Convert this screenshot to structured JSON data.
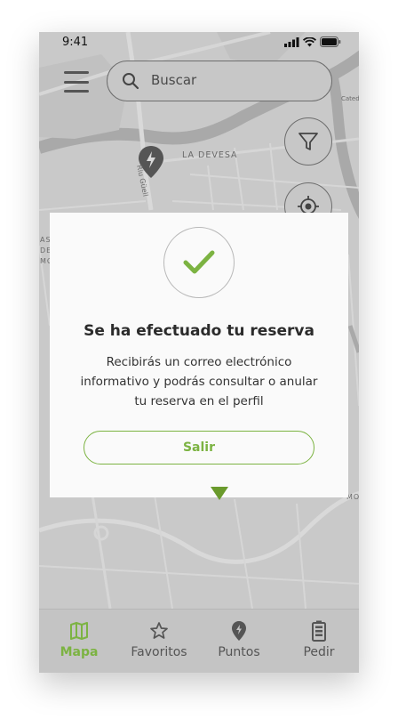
{
  "status_bar": {
    "time": "9:41"
  },
  "search": {
    "placeholder": "Buscar"
  },
  "map": {
    "labels": {
      "la_devesa": "LA DEVESA",
      "riu_guell": "Riu Güell",
      "cate": "Cated",
      "left_block": [
        "ASSI",
        "DE",
        "MO"
      ],
      "mo": "MO"
    }
  },
  "modal": {
    "title": "Se ha efectuado tu reserva",
    "message": "Recibirás un correo electrónico informativo y podrás consultar o anular tu reserva en el perfil",
    "button_label": "Salir"
  },
  "tabbar": {
    "tabs": [
      {
        "label": "Mapa",
        "icon": "map-icon",
        "active": true
      },
      {
        "label": "Favoritos",
        "icon": "star-icon",
        "active": false
      },
      {
        "label": "Puntos",
        "icon": "map-pin-icon",
        "active": false
      },
      {
        "label": "Pedir",
        "icon": "battery-icon",
        "active": false
      }
    ]
  },
  "colors": {
    "accent": "#7cb342",
    "map_bg": "#c9c9c9",
    "card_bg": "#fafafa"
  }
}
